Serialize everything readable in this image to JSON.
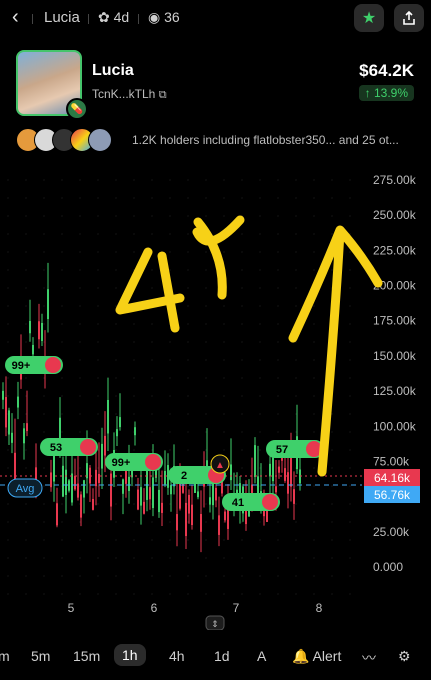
{
  "header": {
    "title": "Lucia",
    "age": "4d",
    "views": "36"
  },
  "token": {
    "name": "Lucia",
    "address": "TcnK...kTLh",
    "price": "$64.2K",
    "change": "↑ 13.9%"
  },
  "holders": {
    "text": "1.2K holders including flatlobster350... and 25 ot..."
  },
  "chart_data": {
    "type": "candlestick",
    "y_ticks": [
      "275.00k",
      "250.00k",
      "225.00k",
      "200.00k",
      "175.00k",
      "150.00k",
      "125.00k",
      "100.00k",
      "75.00k",
      "25.00k",
      "0.000"
    ],
    "x_ticks": [
      "5",
      "6",
      "7",
      "8"
    ],
    "current_price_label": "64.16k",
    "avg_label": "56.76k",
    "avg_tag": "Avg",
    "trade_bubbles": [
      "99+",
      "53",
      "99+",
      "2",
      "41",
      "57"
    ],
    "annotation": "4x"
  },
  "timeframes": [
    "m",
    "5m",
    "15m",
    "1h",
    "4h",
    "1d",
    "A"
  ],
  "selected_timeframe": "1h",
  "alert_label": "Alert",
  "colors": {
    "green": "#3fd06b",
    "red": "#e8384f",
    "accent_blue": "#3fa9f5",
    "scribble": "#f7d117"
  }
}
